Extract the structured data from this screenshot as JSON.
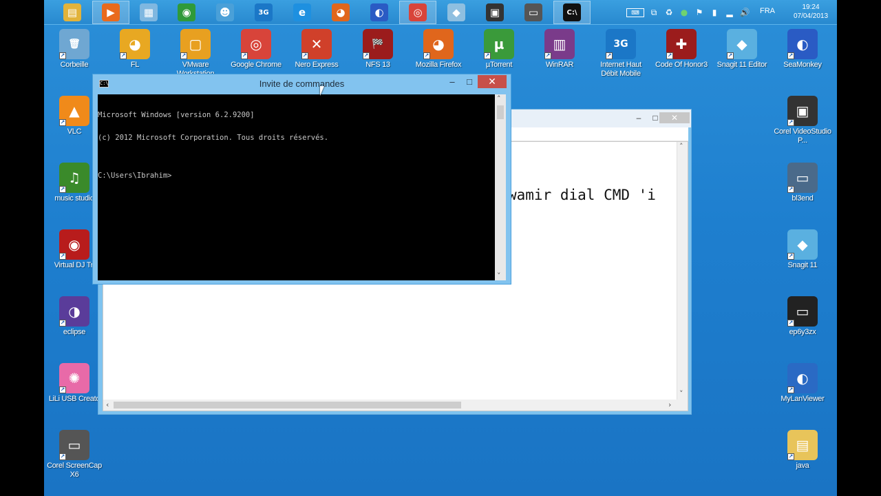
{
  "taskbar": {
    "apps": [
      {
        "name": "file-explorer",
        "glyph": "▤",
        "color": "#e2b33b",
        "active": false
      },
      {
        "name": "media-player",
        "glyph": "▶",
        "color": "#e96a1d",
        "active": true
      },
      {
        "name": "monitor-app",
        "glyph": "▦",
        "color": "#7fb7e0",
        "active": false
      },
      {
        "name": "internet-download",
        "glyph": "◉",
        "color": "#2f9a3a",
        "active": false
      },
      {
        "name": "people-app",
        "glyph": "☻",
        "color": "#4aa0d8",
        "active": false
      },
      {
        "name": "3g-modem",
        "glyph": "3G",
        "color": "#1b77c7",
        "active": false
      },
      {
        "name": "internet-explorer",
        "glyph": "e",
        "color": "#1e90e0",
        "active": false
      },
      {
        "name": "firefox",
        "glyph": "◕",
        "color": "#e0661c",
        "active": false
      },
      {
        "name": "seamonkey",
        "glyph": "◐",
        "color": "#2a5bc4",
        "active": false
      },
      {
        "name": "chrome",
        "glyph": "◎",
        "color": "#d8443a",
        "active": true
      },
      {
        "name": "snagit-editor",
        "glyph": "◆",
        "color": "#8fbfe0",
        "active": false
      },
      {
        "name": "corel-videostudio",
        "glyph": "▣",
        "color": "#333333",
        "active": false
      },
      {
        "name": "corel-screencap",
        "glyph": "▭",
        "color": "#555555",
        "active": false
      },
      {
        "name": "command-prompt",
        "glyph": "C:\\",
        "color": "#111111",
        "active": true
      }
    ],
    "language": "FRA",
    "time": "19:24",
    "date": "07/04/2013"
  },
  "desktop": {
    "icons_top": [
      {
        "label": "Corbeille",
        "glyph": "🗑",
        "color": "#6fa7d2"
      },
      {
        "label": "FL",
        "glyph": "◕",
        "color": "#e8a822"
      },
      {
        "label": "VMware Workstation",
        "glyph": "▢",
        "color": "#e8a020"
      },
      {
        "label": "Google Chrome",
        "glyph": "◎",
        "color": "#d8443a"
      },
      {
        "label": "Nero Express",
        "glyph": "✕",
        "color": "#d0402a"
      },
      {
        "label": "NFS 13",
        "glyph": "🏁",
        "color": "#9b1c1c"
      },
      {
        "label": "Mozilla Firefox",
        "glyph": "◕",
        "color": "#e0661c"
      },
      {
        "label": "µTorrent",
        "glyph": "µ",
        "color": "#3a9a3a"
      },
      {
        "label": "WinRAR",
        "glyph": "▥",
        "color": "#7a3b8a"
      },
      {
        "label": "Internet Haut Débit Mobile",
        "glyph": "3G",
        "color": "#1b77c7"
      },
      {
        "label": "Code Of Honor3",
        "glyph": "✚",
        "color": "#9b1c1c"
      },
      {
        "label": "Snagit 11 Editor",
        "glyph": "◆",
        "color": "#5ab0e0"
      },
      {
        "label": "SeaMonkey",
        "glyph": "◐",
        "color": "#2a5bc4"
      }
    ],
    "icons_left": [
      {
        "label": "VLC",
        "glyph": "▲",
        "color": "#f08a1a"
      },
      {
        "label": "music studio",
        "glyph": "♫",
        "color": "#3a8a2a"
      },
      {
        "label": "Virtual DJ Tri",
        "glyph": "◉",
        "color": "#b81c1c"
      },
      {
        "label": "eclipse",
        "glyph": "◑",
        "color": "#5a3c9a"
      },
      {
        "label": "LiLi USB Creato",
        "glyph": "✺",
        "color": "#e86aa8"
      },
      {
        "label": "Corel ScreenCap X6",
        "glyph": "▭",
        "color": "#555555"
      }
    ],
    "icons_right": [
      {
        "label": "Corel VideoStudio P...",
        "glyph": "▣",
        "color": "#333333"
      },
      {
        "label": "bl3end",
        "glyph": "▭",
        "color": "#4a6a8a"
      },
      {
        "label": "Snagit 11",
        "glyph": "◆",
        "color": "#5ab0e0"
      },
      {
        "label": "ep6y3zx",
        "glyph": "▭",
        "color": "#222222"
      },
      {
        "label": "MyLanViewer",
        "glyph": "◐",
        "color": "#2a6ac4"
      },
      {
        "label": "java",
        "glyph": "▤",
        "color": "#e8c45a"
      }
    ]
  },
  "editor_window": {
    "minimize": "–",
    "maximize": "□",
    "close": "✕",
    "content_text": "wamir dial CMD 'i"
  },
  "cmd_window": {
    "title": "Invite de commandes",
    "minimize": "–",
    "maximize": "□",
    "close": "✕",
    "lines": [
      "Microsoft Windows [version 6.2.9200]",
      "(c) 2012 Microsoft Corporation. Tous droits réservés.",
      "",
      "C:\\Users\\Ibrahim>"
    ]
  }
}
